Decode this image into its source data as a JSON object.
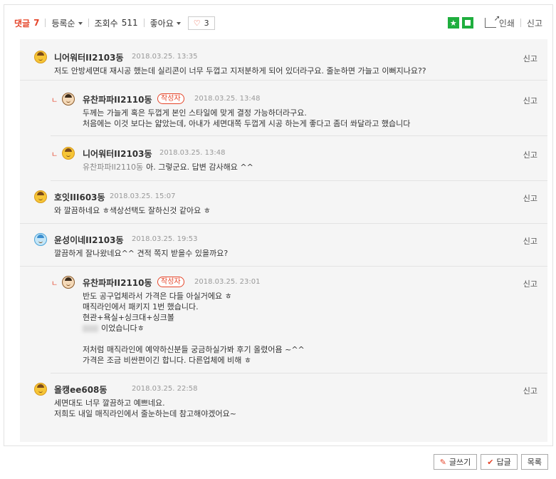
{
  "toolbar": {
    "comment_label": "댓글",
    "comment_count": "7",
    "sort_label": "등록순",
    "views_label": "조회수",
    "views_count": "511",
    "like_label": "좋아요",
    "like_count": "3",
    "heart_icon": "♡",
    "print_label": "인쇄",
    "report_label": "신고",
    "accent_color": "#e5452a",
    "green_color": "#1fae3e"
  },
  "comments": [
    {
      "nick": "니어워터II2103동",
      "date": "2018.03.25. 13:35",
      "report": "신고",
      "lines": [
        "저도 안방세면대 재시공 했는데 실리콘이 너무 두껍고 지저분하게 되어 있더라구요. 줄눈하면 가늘고 이뻐지나요??"
      ]
    },
    {
      "nick": "유찬파파II2110동",
      "badge": "작성자",
      "date": "2018.03.25. 13:48",
      "report": "신고",
      "lines": [
        "두께는 가늘게 혹은 두껍게 본인 스타일에 맞게 결정 가능하더라구요.",
        "처음에는 이것 보다는 얇았는데, 아내가 세면대쪽 두껍게 시공 하는게 좋다고 좀더 쏴달라고 했습니다"
      ]
    },
    {
      "nick": "니어워터II2103동",
      "date": "2018.03.25. 13:48",
      "report": "신고",
      "mention": "유찬파파II2110동",
      "lines": [
        "아. 그렇군요. 답변 감사해요 ^^"
      ]
    },
    {
      "nick": "호잇III603동",
      "date": "2018.03.25. 15:07",
      "report": "신고",
      "lines": [
        "와 깔끔하네요 ㅎ색상선택도 잘하신것 같아요 ㅎ"
      ]
    },
    {
      "nick": "윤성이네II2103동",
      "date": "2018.03.25. 19:53",
      "report": "신고",
      "lines": [
        "깔끔하게 잘나왔네요^^ 견적 쪽지 받을수 있을까요?"
      ]
    },
    {
      "nick": "유찬파파II2110동",
      "badge": "작성자",
      "date": "2018.03.25. 23:01",
      "report": "신고",
      "lines": [
        "반도 공구업체라서 가격은 다들 아실거에요 ㅎ",
        "매직라인에서 패키지 1번 했습니다.",
        "현관+욕실+싱크대+싱크볼",
        "이었습니다ㅎ",
        "",
        "저처럼 매직라인에 예약하신분들 궁금하실가봐 후기 올렸어욤 ~^^",
        "가격은 조금 비싼편이긴 합니다. 다른업체에 비해 ㅎ"
      ]
    },
    {
      "nick": "올캥ee608동",
      "date": "2018.03.25. 22:58",
      "report": "신고",
      "lines": [
        "세면대도 너무 깔끔하고 예쁘네요.",
        "저희도 내일 매직라인에서 줄눈하는데 참고해야겠어요~"
      ]
    }
  ],
  "buttons": {
    "write": "글쓰기",
    "reply": "답글",
    "list": "목록"
  }
}
